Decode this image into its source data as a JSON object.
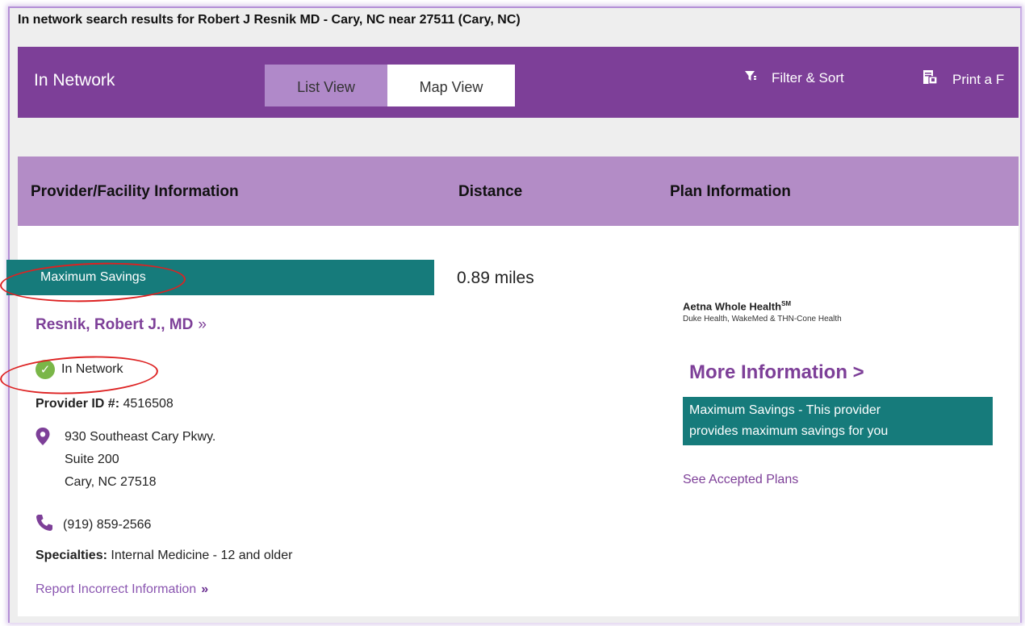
{
  "page": {
    "heading": "In network search results for Robert J Resnik MD - Cary, NC near 27511 (Cary, NC)"
  },
  "topbar": {
    "title": "In Network",
    "views": [
      "List View",
      "Map View"
    ],
    "filter_label": "Filter & Sort",
    "print_label": "Print a F"
  },
  "columns": {
    "provider": "Provider/Facility Information",
    "distance": "Distance",
    "plan": "Plan Information"
  },
  "result": {
    "banner": "Maximum Savings",
    "distance": "0.89 miles",
    "name": "Resnik, Robert J., MD",
    "name_chevron": "»",
    "network_status": "In Network",
    "provider_id_label": "Provider ID #:",
    "provider_id": "4516508",
    "address": [
      "930 Southeast Cary Pkwy.",
      "Suite 200",
      "Cary, NC 27518"
    ],
    "phone": "(919) 859-2566",
    "specialties_label": "Specialties:",
    "specialties": "Internal Medicine - 12 and older",
    "report_link": "Report Incorrect Information",
    "report_chevron": "»"
  },
  "plan": {
    "name": "Aetna Whole Health",
    "name_mark": "SM",
    "sub": "Duke Health, WakeMed & THN-Cone Health",
    "more_info": "More Information >",
    "savings_line1": "Maximum Savings - This provider",
    "savings_line2": "provides maximum savings for you",
    "accepted_link": "See Accepted Plans"
  },
  "colors": {
    "brand_purple": "#7d3f98",
    "header_lilac": "#b38cc6",
    "teal": "#167b7b",
    "check_green": "#7ab648",
    "annotation_red": "#dd2222"
  },
  "icons": [
    "filter-icon",
    "print-icon",
    "check-circle-icon",
    "map-pin-icon",
    "phone-icon"
  ]
}
